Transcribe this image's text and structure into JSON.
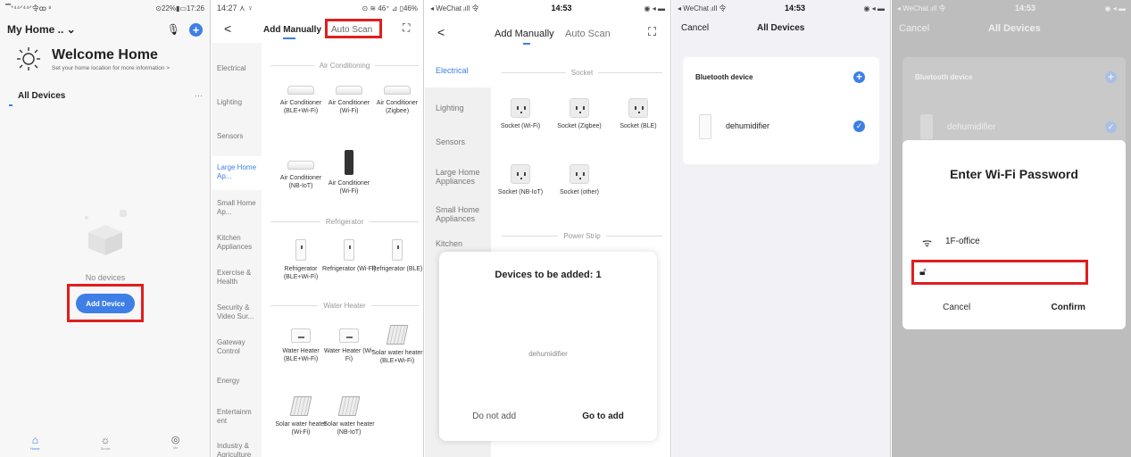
{
  "s1": {
    "status_left": "▔ᐩ⁴⁴ᐟ⁴⁴ᐟ令ꝏ ⁸",
    "status_right": "⊙22%▮▭17:26",
    "home_title": "My Home .. ⌄",
    "welcome": "Welcome Home",
    "welcome_sub": "Set your home location for more information >",
    "all_devices": "All Devices",
    "more": "···",
    "no_devices": "No devices",
    "add_device": "Add Device",
    "tabs": [
      "Home",
      "Smart",
      "Me"
    ]
  },
  "s2": {
    "status_left": "14:27 ⋏ ♀",
    "status_right": "⊙ ≋ 46⁺ ⊿ ▯46%",
    "back": "<",
    "tab_manual": "Add Manually",
    "tab_auto": "Auto Scan",
    "categories": [
      "Electrical",
      "Lighting",
      "Sensors",
      "Large Home Ap...",
      "Small Home Ap...",
      "Kitchen Appliances",
      "Exercise & Health",
      "Security & Video Sur...",
      "Gateway Control",
      "Energy",
      "Entertainm ent",
      "Industry & Agriculture"
    ],
    "sec_ac": "Air Conditioning",
    "ac_devices": [
      "Air Conditioner (BLE+Wi-Fi)",
      "Air Conditioner (Wi-Fi)",
      "Air Conditioner (Zigbee)",
      "Air Conditioner (NB-IoT)",
      "Air Conditioner (Wi-Fi)"
    ],
    "sec_fridge": "Refrigerator",
    "fridge_devices": [
      "Refrigerator (BLE+Wi-Fi)",
      "Refrigerator (Wi-Fi)",
      "Refrigerator (BLE)"
    ],
    "sec_wh": "Water Heater",
    "wh_devices": [
      "Water Heater (BLE+Wi-Fi)",
      "Water Heater (Wi-Fi)",
      "Solar water heater (BLE+Wi-Fi)",
      "Solar water heater (Wi-Fi)",
      "Solar water heater (NB-IoT)"
    ]
  },
  "s3": {
    "status_left": "◂ WeChat ᵢıll 令",
    "status_time": "14:53",
    "status_right": "◉ ◂ ▬",
    "back": "<",
    "tab_manual": "Add Manually",
    "tab_auto": "Auto Scan",
    "categories": [
      "Electrical",
      "Lighting",
      "Sensors",
      "Large Home Appliances",
      "Small Home Appliances",
      "Kitchen"
    ],
    "sec_socket": "Socket",
    "sockets": [
      "Socket (Wi-Fi)",
      "Socket (Zigbee)",
      "Socket (BLE)",
      "Socket (NB-IoT)",
      "Socket (other)"
    ],
    "sec_strip": "Power Strip",
    "dialog_title": "Devices to be added: 1",
    "dialog_device": "dehumidifier",
    "btn_no": "Do not add",
    "btn_go": "Go to add"
  },
  "s4": {
    "status_left": "◂ WeChat ᵢıll 令",
    "status_time": "14:53",
    "status_right": "◉ ◂ ▬",
    "cancel": "Cancel",
    "title": "All Devices",
    "bt_label": "Bluetooth device",
    "device": "dehumidifier"
  },
  "s5": {
    "status_left": "◂ WeChat ᵢıll 令",
    "status_time": "14:53",
    "status_right": "◉ ◂ ▬",
    "cancel": "Cancel",
    "title": "All Devices",
    "bt_label": "Bluetooth device",
    "device": "dehumidifier",
    "dialog_title": "Enter Wi-Fi Password",
    "ssid": "1F-office",
    "password_placeholder": "",
    "btn_cancel": "Cancel",
    "btn_confirm": "Confirm"
  },
  "colors": {
    "accent": "#3d7fe6",
    "highlight": "#e01e1e"
  }
}
